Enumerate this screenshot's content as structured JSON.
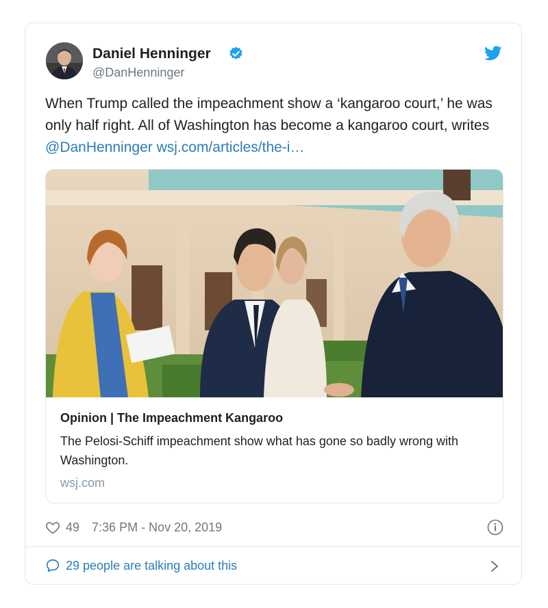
{
  "author": {
    "name": "Daniel Henninger",
    "handle": "@DanHenninger"
  },
  "tweet": {
    "text_plain": "When Trump called the impeachment show a ‘kangaroo court,’ he was only half right. All of Washington has become a kangaroo court, writes",
    "mention": "@DanHenninger",
    "url": "wsj.com/articles/the-i…"
  },
  "card": {
    "title": "Opinion | The Impeachment Kangaroo",
    "description": "The Pelosi-Schiff impeachment show what has gone so badly wrong with Washington.",
    "domain": "wsj.com"
  },
  "meta": {
    "likes": "49",
    "timestamp": "7:36 PM - Nov 20, 2019"
  },
  "footer": {
    "talking": "29 people are talking about this"
  },
  "colors": {
    "link": "#2b7bb9",
    "verified": "#1da1f2",
    "muted": "#697882"
  }
}
